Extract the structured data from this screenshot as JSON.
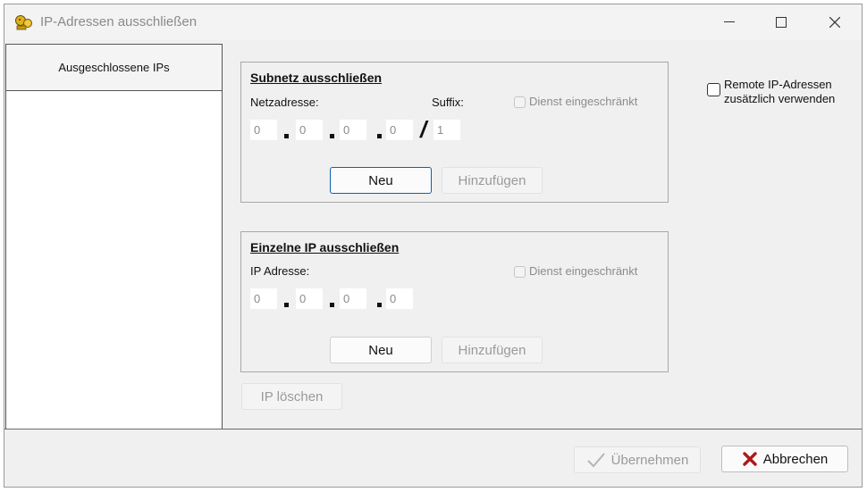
{
  "window": {
    "title": "IP-Adressen ausschließen"
  },
  "sidebar": {
    "header": "Ausgeschlossene IPs"
  },
  "subnet": {
    "title": "Subnetz ausschließen",
    "netzadresse_label": "Netzadresse:",
    "suffix_label": "Suffix:",
    "dienst_label": "Dienst eingeschränkt",
    "octets": [
      "0",
      "0",
      "0",
      "0"
    ],
    "suffix": "1",
    "neu_label": "Neu",
    "hinzufuegen_label": "Hinzufügen"
  },
  "single": {
    "title": "Einzelne IP ausschließen",
    "ip_label": "IP Adresse:",
    "dienst_label": "Dienst eingeschränkt",
    "octets": [
      "0",
      "0",
      "0",
      "0"
    ],
    "neu_label": "Neu",
    "hinzufuegen_label": "Hinzufügen"
  },
  "remote": {
    "label_line1": "Remote IP-Adressen",
    "label_line2": "zusätzlich verwenden"
  },
  "ip_loeschen_label": "IP löschen",
  "footer": {
    "uebernehmen_label": "Übernehmen",
    "abbrechen_label": "Abbrechen"
  },
  "colors": {
    "accent": "#0f5fb5",
    "cancel_red": "#b01818"
  }
}
